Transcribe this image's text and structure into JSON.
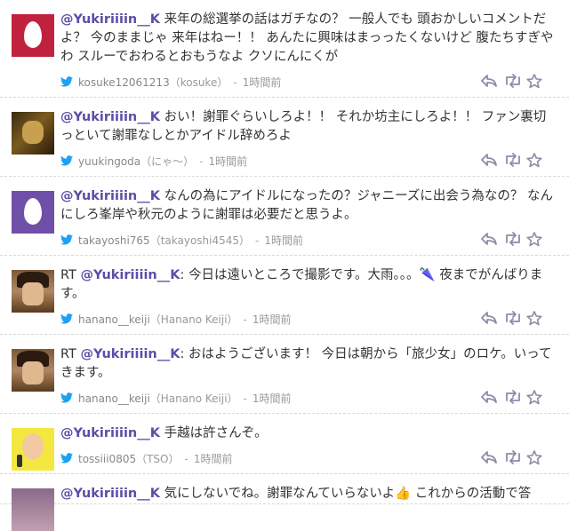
{
  "tweets": [
    {
      "prefix": "",
      "mention": "@Yukiriiiin__K",
      "body": " 来年の総選挙の話はガチなの？ 一般人でも 頭おかしいコメントだよ？ 今のままじゃ 来年はねー！！ あんたに興味はまっったくないけど 腹たちすぎやわ スルーでおわるとおもうなよ クソにんにくが",
      "screen_name": "kosuke12061213",
      "display_name": "（kosuke）",
      "time": "1時間前",
      "avatar": "egg-red"
    },
    {
      "prefix": "",
      "mention": "@Yukiriiiin__K",
      "body": " おい！謝罪ぐらいしろよ！！ それか坊主にしろよ！！ ファン裏切っといて謝罪なしとかアイドル辞めろよ",
      "screen_name": "yuukingoda",
      "display_name": "（にゃ～）",
      "time": "1時間前",
      "avatar": "dark"
    },
    {
      "prefix": "",
      "mention": "@Yukiriiiin__K",
      "body": " なんの為にアイドルになったの？ジャニーズに出会う為なの？ なんにしろ峯岸や秋元のように謝罪は必要だと思うよ。",
      "screen_name": "takayoshi765",
      "display_name": "（takayoshi4545）",
      "time": "1時間前",
      "avatar": "egg-purple"
    },
    {
      "prefix": "RT ",
      "mention": "@Yukiriiiin__K",
      "body": ": 今日は遠いところで撮影です。大雨。。。🌂 夜までがんばります。",
      "screen_name": "hanano__keiji",
      "display_name": "（Hanano Keiji）",
      "time": "1時間前",
      "avatar": "fighter"
    },
    {
      "prefix": "RT ",
      "mention": "@Yukiriiiin__K",
      "body": ": おはようございます！ 今日は朝から「旅少女」のロケ。いってきます。",
      "screen_name": "hanano__keiji",
      "display_name": "（Hanano Keiji）",
      "time": "1時間前",
      "avatar": "fighter"
    },
    {
      "prefix": "",
      "mention": "@Yukiriiiin__K",
      "body": " 手越は許さんぞ。",
      "screen_name": "tossiii0805",
      "display_name": "（TSO）",
      "time": "1時間前",
      "avatar": "yellow"
    },
    {
      "prefix": "",
      "mention": "@Yukiriiiin__K",
      "body": " 気にしないでね。謝罪なんていらないよ👍 これからの活動で答",
      "screen_name": "",
      "display_name": "",
      "time": "",
      "avatar": "partial"
    }
  ],
  "colors": {
    "mention": "#5b4ea6",
    "twitter_blue": "#1da1f2",
    "action_icon": "#8c8ca8"
  },
  "icons": {
    "bird": "twitter-bird-icon",
    "reply": "reply-icon",
    "retweet": "retweet-icon",
    "favorite": "star-icon"
  }
}
